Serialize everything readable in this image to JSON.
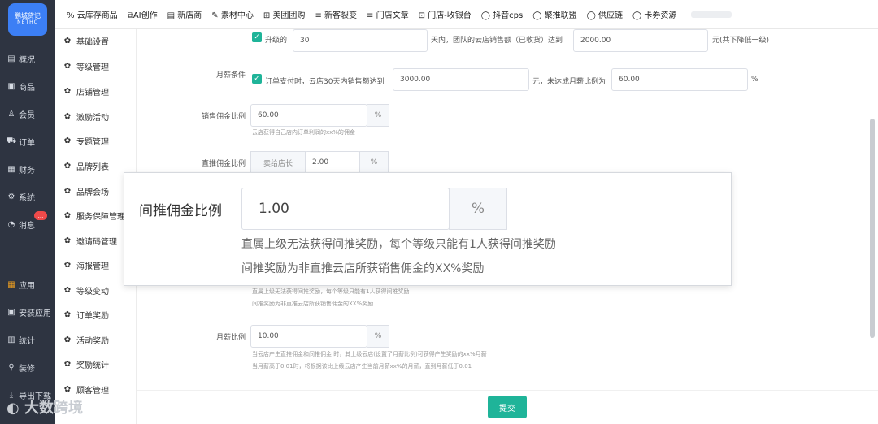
{
  "logo": {
    "line1": "鹏城贷记",
    "line2": "NETHC"
  },
  "left_nav": [
    {
      "icon": "chart-icon",
      "glyph": "▤",
      "label": "概况"
    },
    {
      "icon": "goods-icon",
      "glyph": "▣",
      "label": "商品"
    },
    {
      "icon": "member-icon",
      "glyph": "♙",
      "label": "会员"
    },
    {
      "icon": "cart-icon",
      "glyph": "⛟",
      "label": "订单"
    },
    {
      "icon": "finance-icon",
      "glyph": "▦",
      "label": "财务"
    },
    {
      "icon": "gear-icon",
      "glyph": "⚙",
      "label": "系统"
    },
    {
      "icon": "message-icon",
      "glyph": "◔",
      "label": "消息"
    },
    {
      "icon": "apps-icon",
      "glyph": "▦",
      "label": "应用"
    },
    {
      "icon": "install-icon",
      "glyph": "▣",
      "label": "安装应用"
    },
    {
      "icon": "stats-icon",
      "glyph": "▥",
      "label": "统计"
    },
    {
      "icon": "decorate-icon",
      "glyph": "⚲",
      "label": "装修"
    },
    {
      "icon": "download-icon",
      "glyph": "⤓",
      "label": "导出下载"
    }
  ],
  "message_badge": "...",
  "top_nav": [
    {
      "glyph": "%",
      "label": "云库存商品"
    },
    {
      "glyph": "⧉",
      "label": "AI创作"
    },
    {
      "glyph": "▤",
      "label": "新店商"
    },
    {
      "glyph": "✎",
      "label": "素材中心"
    },
    {
      "glyph": "⊞",
      "label": "美团团购"
    },
    {
      "glyph": "≡",
      "label": "新客裂变"
    },
    {
      "glyph": "≡",
      "label": "门店文章"
    },
    {
      "glyph": "⊡",
      "label": "门店-收银台"
    },
    {
      "glyph": "◯",
      "label": "抖音cps"
    },
    {
      "glyph": "◯",
      "label": "聚推联盟"
    },
    {
      "glyph": "◯",
      "label": "供应链"
    },
    {
      "glyph": "◯",
      "label": "卡券资源"
    }
  ],
  "sub_nav": [
    "基础设置",
    "等级管理",
    "店铺管理",
    "激励活动",
    "专题管理",
    "品牌列表",
    "品牌会场",
    "服务保障管理",
    "邀请码管理",
    "海报管理",
    "等级变动",
    "订单奖励",
    "活动奖励",
    "奖励统计",
    "顾客管理"
  ],
  "form": {
    "row1": {
      "checkbox_label": "升级的",
      "value1": "30",
      "text1": "天内，团队的云店销售额（已收货）达到",
      "value2": "2000.00",
      "text2": "元(共下降低一级)"
    },
    "row2": {
      "label": "月薪条件",
      "checkbox_label": "订单支付时，云店30天内销售额达到",
      "value1": "3000.00",
      "text1": "元，未达成月薪比例为",
      "value2": "60.00",
      "suffix": "%"
    },
    "sales": {
      "label": "销售佣金比例",
      "value": "60.00",
      "suffix": "%",
      "hint": "云店获得自己店内订单利润的xx%的佣金"
    },
    "direct": {
      "label": "直推佣金比例",
      "prefix": "卖给店长",
      "value": "2.00",
      "suffix": "%"
    },
    "indirect_hint1": "直属上级无法获得间推奖励，每个等级只能有1人获得间推奖励",
    "indirect_hint2": "间推奖励为非直推云店所获销售佣金的XX%奖励",
    "monthly": {
      "label": "月薪比例",
      "value": "10.00",
      "suffix": "%",
      "hint1": "当云店产生直推佣金和间推佣金 时，其上级云店(设置了月薪比例)可获得产生奖励的xx%月薪",
      "hint2": "当月薪高于0.01时，将根据该比上级云店产生当前月薪xx%的月薪，直到月薪低于0.01"
    },
    "submit": "提交"
  },
  "overlay": {
    "label": "间推佣金比例",
    "value": "1.00",
    "suffix": "%",
    "hint1": "直属上级无法获得间推奖励，每个等级只能有1人获得间推奖励",
    "hint2": "间推奖励为非直推云店所获销售佣金的XX%奖励"
  },
  "watermark": "大数跨境",
  "colors": {
    "accent": "#1fb499",
    "sidebar": "#2e3441",
    "badge": "#ef4a4a",
    "logo": "#3c7ff5"
  }
}
